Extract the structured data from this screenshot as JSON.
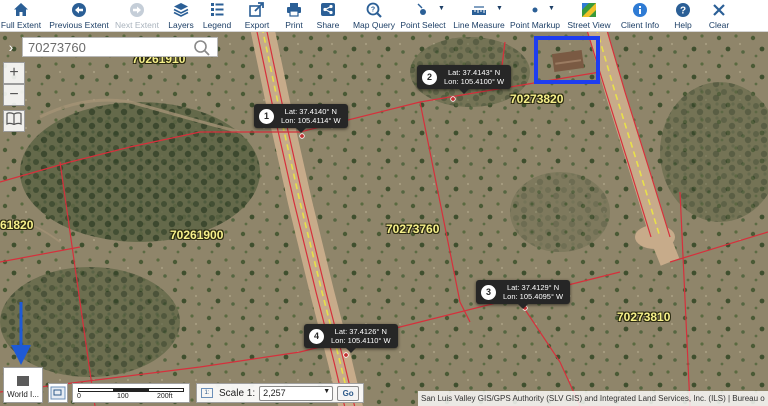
{
  "toolbar": [
    {
      "name": "full-extent-button",
      "icon": "home-icon",
      "label": "Full Extent",
      "enabled": true
    },
    {
      "name": "previous-extent-button",
      "icon": "back-arrow-icon",
      "label": "Previous Extent",
      "enabled": true
    },
    {
      "name": "next-extent-button",
      "icon": "forward-arrow-icon",
      "label": "Next Extent",
      "enabled": false
    },
    {
      "name": "layers-button",
      "icon": "layers-icon",
      "label": "Layers",
      "enabled": true
    },
    {
      "name": "legend-button",
      "icon": "legend-icon",
      "label": "Legend",
      "enabled": true
    },
    {
      "name": "export-button",
      "icon": "export-icon",
      "label": "Export",
      "enabled": true
    },
    {
      "name": "print-button",
      "icon": "printer-icon",
      "label": "Print",
      "enabled": true
    },
    {
      "name": "share-button",
      "icon": "share-icon",
      "label": "Share",
      "enabled": true
    },
    {
      "name": "map-query-button",
      "icon": "query-icon",
      "label": "Map Query",
      "enabled": true
    },
    {
      "name": "point-select-button",
      "icon": "point-select-icon",
      "label": "Point Select",
      "enabled": true
    },
    {
      "name": "line-measure-button",
      "icon": "ruler-icon",
      "label": "Line Measure",
      "enabled": true
    },
    {
      "name": "point-markup-button",
      "icon": "point-markup-icon",
      "label": "Point Markup",
      "enabled": true
    },
    {
      "name": "street-view-button",
      "icon": "street-view-icon",
      "label": "Street View",
      "enabled": true
    },
    {
      "name": "client-info-button",
      "icon": "info-icon",
      "label": "Client Info",
      "enabled": true
    },
    {
      "name": "help-button",
      "icon": "help-icon",
      "label": "Help",
      "enabled": true
    },
    {
      "name": "clear-button",
      "icon": "close-icon",
      "label": "Clear",
      "enabled": true
    }
  ],
  "search": {
    "value": "70273760",
    "expand_icon": "chevron-right-icon"
  },
  "zoom": {
    "in": "+",
    "out": "−"
  },
  "bookmark_icon": "book-icon",
  "parcels": [
    "70261910",
    "70273820",
    "61820",
    "70261900",
    "70273760",
    "70273810"
  ],
  "callouts": [
    {
      "num": "1",
      "lat": "Lat: 37.4140° N",
      "lon": "Lon: 105.4114° W"
    },
    {
      "num": "2",
      "lat": "Lat: 37.4143° N",
      "lon": "Lon: 105.4100° W"
    },
    {
      "num": "3",
      "lat": "Lat: 37.4129° N",
      "lon": "Lon: 105.4095° W"
    },
    {
      "num": "4",
      "lat": "Lat: 37.4126° N",
      "lon": "Lon: 105.4110° W"
    }
  ],
  "basemap_label": "World I...",
  "scalebar": {
    "t0": "0",
    "t1": "100",
    "t2": "200ft"
  },
  "scale": {
    "label": "Scale 1:",
    "value": "2,257",
    "go": "Go"
  },
  "attribution": "San Luis Valley GIS/GPS Authority (SLV GIS) and Integrated Land Services, Inc. (ILS) | Bureau o",
  "colors": {
    "highlight": "#1e3df0",
    "annotation_arrow": "#1e5ad6",
    "parcel_line": "#d6303c",
    "road_line": "#e8e04a"
  }
}
